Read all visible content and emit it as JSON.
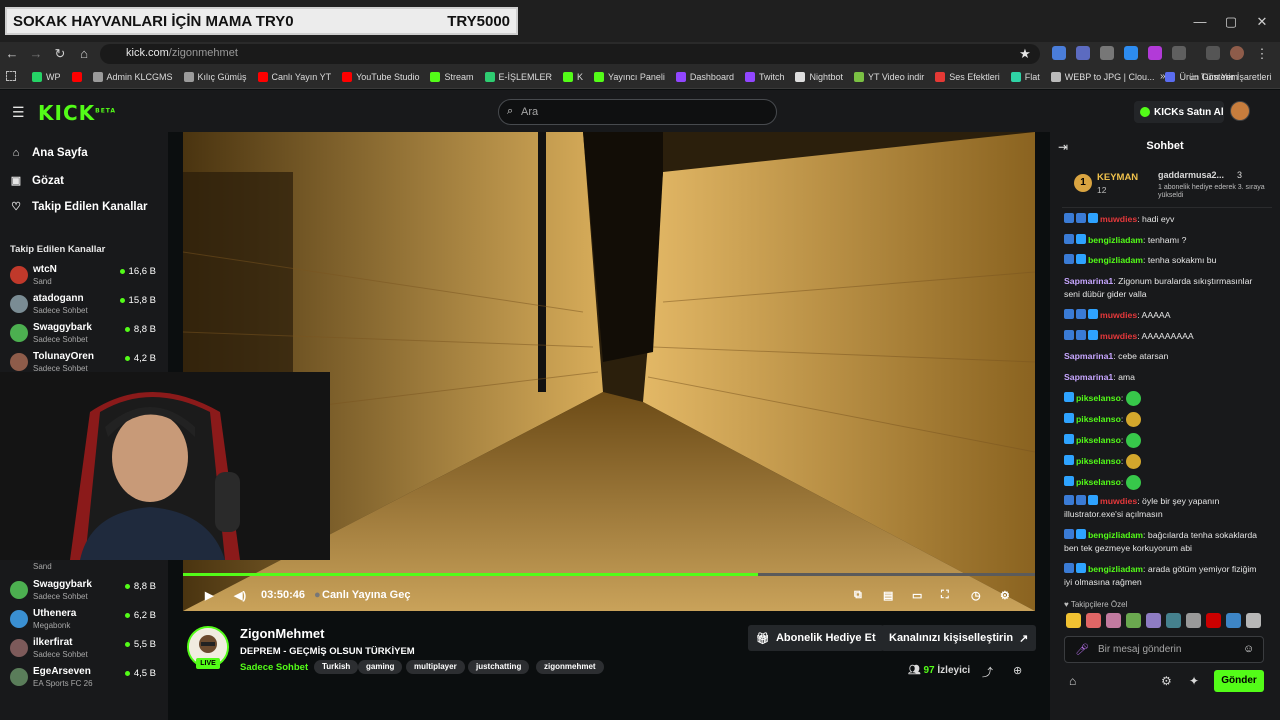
{
  "overlay_banner": {
    "text": "SOKAK HAYVANLARI İÇİN MAMA  TRY0",
    "goal": "TRY5000"
  },
  "browser": {
    "url_host": "kick.com",
    "url_path": "/zigonmehmet",
    "window_controls": [
      "—",
      "▢",
      "✕"
    ],
    "bookmarks": [
      {
        "label": "WP",
        "color": "#25d366"
      },
      {
        "label": "",
        "color": "#ff0000"
      },
      {
        "label": "Admin KLCGMS",
        "color": "#9b9b9b"
      },
      {
        "label": "Kılıç Gümüş",
        "color": "#9b9b9b"
      },
      {
        "label": "Canlı Yayın YT",
        "color": "#ff0000"
      },
      {
        "label": "YouTube Studio",
        "color": "#ff0000"
      },
      {
        "label": "Stream",
        "color": "#53fc18"
      },
      {
        "label": "E-İŞLEMLER",
        "color": "#2ecc71"
      },
      {
        "label": "K",
        "color": "#53fc18"
      },
      {
        "label": "Yayıncı Paneli",
        "color": "#53fc18"
      },
      {
        "label": "Dashboard",
        "color": "#9146ff"
      },
      {
        "label": "Twitch",
        "color": "#9146ff"
      },
      {
        "label": "Nightbot",
        "color": "#dddddd"
      },
      {
        "label": "YT Video indir",
        "color": "#7ac043"
      },
      {
        "label": "Ses Efektleri",
        "color": "#e53935"
      },
      {
        "label": "Flat",
        "color": "#2fd3a6"
      },
      {
        "label": "WEBP to JPG | Clou...",
        "color": "#bbbbbb"
      },
      {
        "label": "Ürün Gösterim",
        "color": "#5a6cf0"
      }
    ],
    "bookmarks_more": "»",
    "all_bookmarks": "Tüm Yer İşaretleri"
  },
  "header": {
    "logo": "KICK",
    "logo_badge": "BETA",
    "search_placeholder": "Ara",
    "kicks_button": "KICKs Satın Al"
  },
  "sidebar": {
    "nav": [
      "Ana Sayfa",
      "Gözat",
      "Takip Edilen Kanallar"
    ],
    "followed_heading": "Takip Edilen Kanallar",
    "channels_top": [
      {
        "name": "wtcN",
        "sub": "Sand",
        "viewers": "16,6 B",
        "color": "#c0392b"
      },
      {
        "name": "atadogann",
        "sub": "Sadece Sohbet",
        "viewers": "15,8 B",
        "color": "#7a8c94"
      },
      {
        "name": "Swaggybark",
        "sub": "Sadece Sohbet",
        "viewers": "8,8 B",
        "color": "#4caf50"
      },
      {
        "name": "TolunayOren",
        "sub": "Sadece Sohbet",
        "viewers": "4,2 B",
        "color": "#8e5c4a"
      }
    ],
    "hidden_sub": "Sand",
    "channels_bottom": [
      {
        "name": "Swaggybark",
        "sub": "Sadece Sohbet",
        "viewers": "8,8 B",
        "color": "#4caf50"
      },
      {
        "name": "Uthenera",
        "sub": "Megabonk",
        "viewers": "6,2 B",
        "color": "#3a8fd1"
      },
      {
        "name": "ilkerfirat",
        "sub": "Sadece Sohbet",
        "viewers": "5,5 B",
        "color": "#7d5a5a"
      },
      {
        "name": "EgeArseven",
        "sub": "EA Sports FC 26",
        "viewers": "4,5 B",
        "color": "#5a7d5a"
      }
    ]
  },
  "player": {
    "time": "03:50:46",
    "go_live": "Canlı Yayına Geç",
    "progress_fraction": 0.675
  },
  "stream": {
    "streamer": "ZigonMehmet",
    "live_label": "LIVE",
    "title": "DEPREM - GEÇMİŞ OLSUN TÜRKİYEM",
    "category": "Sadece Sohbet",
    "tags": [
      "Turkish",
      "gaming",
      "multiplayer",
      "justchatting",
      "zigonmehmet"
    ],
    "gift_button": "Abonelik Hediye Et",
    "customize_button": "Kanalınızı kişiselleştirin",
    "viewers_count": "97",
    "viewers_label": "İzleyici"
  },
  "chat": {
    "title": "Sohbet",
    "pinned": {
      "rank": "1",
      "name": "KEYMAN",
      "count": "12",
      "user": "gaddarmusa2...",
      "user_count": "3",
      "text": "1 abonelik hediye ederek 3. sıraya yükseldi"
    },
    "messages": [
      {
        "user": "muwdies",
        "color": "#e5383b",
        "text": "hadi eyv",
        "badges": [
          "blue",
          "blue",
          "diamond"
        ]
      },
      {
        "user": "bengizliadam",
        "color": "#53fc18",
        "text": "tenhamı ?",
        "badges": [
          "blue",
          "diamond"
        ]
      },
      {
        "user": "bengizliadam",
        "color": "#53fc18",
        "text": "tenha sokakmı bu",
        "badges": [
          "blue",
          "diamond"
        ]
      },
      {
        "user": "Sapmarina1",
        "color": "#c7a6ff",
        "text": "Zigonum buralarda sıkıştırmasınlar seni dübür gider valla",
        "badges": []
      },
      {
        "user": "muwdies",
        "color": "#e5383b",
        "text": "AAAAA",
        "badges": [
          "blue",
          "blue",
          "diamond"
        ]
      },
      {
        "user": "muwdies",
        "color": "#e5383b",
        "text": "AAAAAAAAA",
        "badges": [
          "blue",
          "blue",
          "diamond"
        ]
      },
      {
        "user": "Sapmarina1",
        "color": "#c7a6ff",
        "text": "cebe atarsan",
        "badges": []
      },
      {
        "user": "Sapmarina1",
        "color": "#c7a6ff",
        "text": "ama",
        "badges": []
      },
      {
        "user": "pikselanso",
        "color": "#53fc18",
        "text": "",
        "emote": "#37c84a",
        "badges": [
          "diamond"
        ]
      },
      {
        "user": "pikselanso",
        "color": "#53fc18",
        "text": "",
        "emote": "#d4a72c",
        "badges": [
          "diamond"
        ]
      },
      {
        "user": "pikselanso",
        "color": "#53fc18",
        "text": "",
        "emote": "#37c84a",
        "badges": [
          "diamond"
        ]
      },
      {
        "user": "pikselanso",
        "color": "#53fc18",
        "text": "",
        "emote": "#d4a72c",
        "badges": [
          "diamond"
        ]
      },
      {
        "user": "pikselanso",
        "color": "#53fc18",
        "text": "",
        "emote": "#37c84a",
        "badges": [
          "diamond"
        ]
      },
      {
        "user": "muwdies",
        "color": "#e5383b",
        "text": "öyle bir şey yapanın illustrator.exe'si açılmasın",
        "badges": [
          "blue",
          "blue",
          "diamond"
        ]
      },
      {
        "user": "bengizliadam",
        "color": "#53fc18",
        "text": "bağcılarda tenha sokaklarda ben tek gezmeye korkuyorum abi",
        "badges": [
          "blue",
          "diamond"
        ]
      },
      {
        "user": "bengizliadam",
        "color": "#53fc18",
        "text": "arada götüm yemiyor fiziğim iyi olmasına rağmen",
        "badges": [
          "blue",
          "diamond"
        ]
      }
    ],
    "favorites_label": "♥ Takipçilere Özel",
    "input_placeholder": "Bir mesaj gönderin",
    "send_label": "Gönder"
  }
}
